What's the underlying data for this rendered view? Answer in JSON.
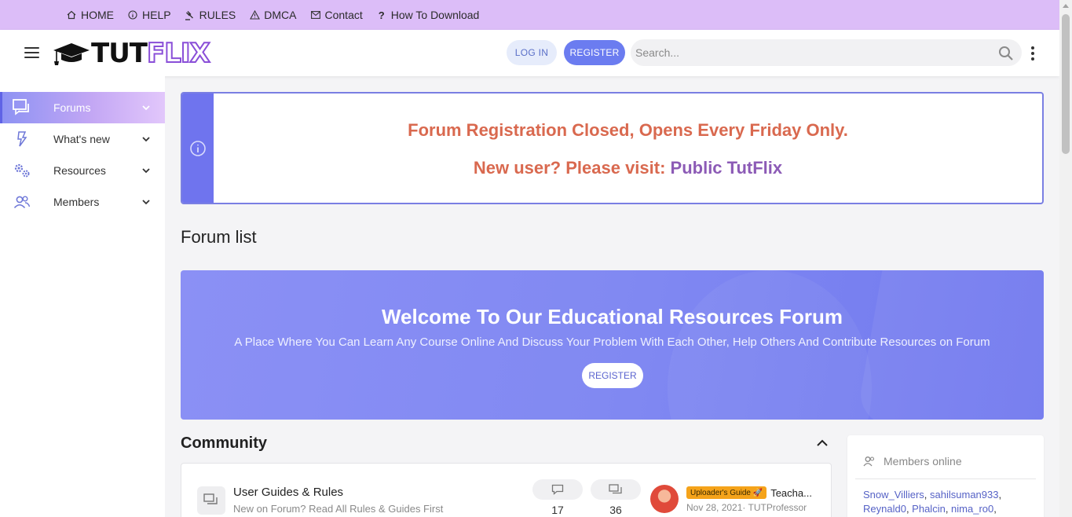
{
  "topnav": {
    "items": [
      {
        "label": "HOME",
        "icon": "home-icon"
      },
      {
        "label": "HELP",
        "icon": "info-icon"
      },
      {
        "label": "RULES",
        "icon": "gavel-icon"
      },
      {
        "label": "DMCA",
        "icon": "warning-icon"
      },
      {
        "label": "Contact",
        "icon": "envelope-icon"
      },
      {
        "label": "How To Download",
        "icon": "question-icon"
      }
    ]
  },
  "header": {
    "logo_left": "TUT",
    "logo_right": "FLIX",
    "login_label": "LOG IN",
    "register_label": "REGISTER",
    "search_placeholder": "Search...",
    "search_value": ""
  },
  "sidebar": {
    "items": [
      {
        "label": "Forums",
        "icon": "forums-icon",
        "active": true
      },
      {
        "label": "What's new",
        "icon": "bolt-icon",
        "active": false
      },
      {
        "label": "Resources",
        "icon": "cogs-icon",
        "active": false
      },
      {
        "label": "Members",
        "icon": "users-icon",
        "active": false
      }
    ]
  },
  "notice": {
    "line1": "Forum Registration Closed, Opens Every Friday Only.",
    "line2_prefix": "New user? Please visit: ",
    "line2_link": "Public TutFlix"
  },
  "main": {
    "title": "Forum list"
  },
  "hero": {
    "title": "Welcome To Our Educational Resources Forum",
    "subtitle": "A Place Where You Can Learn Any Course Online And Discuss Your Problem With Each Other, Help Others And Contribute Resources on Forum",
    "button": "REGISTER"
  },
  "community": {
    "title": "Community",
    "forums": [
      {
        "title": "User Guides & Rules",
        "description": "New on Forum? Read All Rules & Guides First",
        "threads": "17",
        "messages": "36",
        "latest_badge": "Uploader's Guide 🚀",
        "latest_title": "Teacha...",
        "latest_meta": "Nov 28, 2021· TUTProfessor"
      }
    ]
  },
  "members_online": {
    "title": "Members online",
    "names": [
      "Snow_Villiers",
      "sahilsuman933",
      "Reynald0",
      "Phalcin",
      "nima_ro0"
    ]
  },
  "colors": {
    "topbar": "#dcbdf8",
    "accent": "#6b7cf0",
    "notice_text": "#d9694f",
    "notice_link": "#8c5bb6"
  }
}
